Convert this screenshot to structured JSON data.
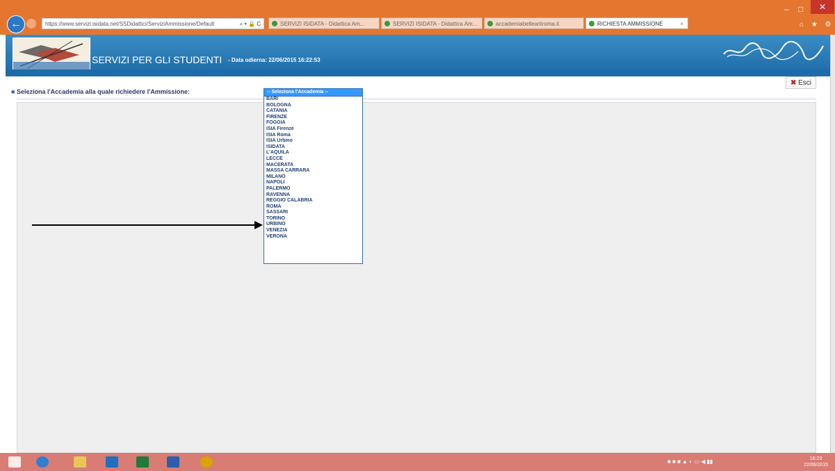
{
  "browser": {
    "address": "https://www.servizi.isidata.net/SSDidattici/ServiziAmmissione/Default",
    "tabs": [
      {
        "label": "SERVIZI ISIDATA - Didattica Am...",
        "active": false
      },
      {
        "label": "SERVIZI ISIDATA - Didattica Am...",
        "active": false
      },
      {
        "label": "accademiabelleartiroma.it",
        "active": false
      },
      {
        "label": "RICHIESTA AMMISSIONE",
        "active": true
      }
    ],
    "window_controls": {
      "minimize": "–",
      "maximize": "□",
      "close": "✕"
    }
  },
  "header": {
    "title": "SERVIZI PER GLI STUDENTI",
    "date": "- Data odierna: 22/06/2015 16:22:53"
  },
  "page": {
    "exit_label": "Esci",
    "question": "Seleziona l'Accademia alla quale richiedere l'Ammissione:",
    "select": {
      "selected": "-- Seleziona l'Accademia --",
      "options": [
        "BARI",
        "BOLOGNA",
        "CATANIA",
        "FIRENZE",
        "FOGGIA",
        "ISIA Firenze",
        "ISIA Roma",
        "ISIA Urbino",
        "ISIDATA",
        "L'AQUILA",
        "LECCE",
        "MACERATA",
        "MASSA CARRARA",
        "MILANO",
        "NAPOLI",
        "PALERMO",
        "RAVENNA",
        "REGGIO CALABRIA",
        "ROMA",
        "SASSARI",
        "TORINO",
        "URBINO",
        "VENEZIA",
        "VERONA"
      ]
    }
  },
  "taskbar": {
    "apps": [
      "windows-start-icon",
      "ie-icon",
      "explorer-icon",
      "outlook-icon",
      "excel-icon",
      "word-icon",
      "chrome-icon"
    ],
    "clock_time": "16:23",
    "clock_date": "22/06/2015"
  },
  "colors": {
    "titlebar": "#e5762f",
    "header": "#1d6ba8",
    "dropdown_border": "#2b6db4",
    "selected_option": "#3399ff",
    "taskbar": "#d87c74"
  }
}
